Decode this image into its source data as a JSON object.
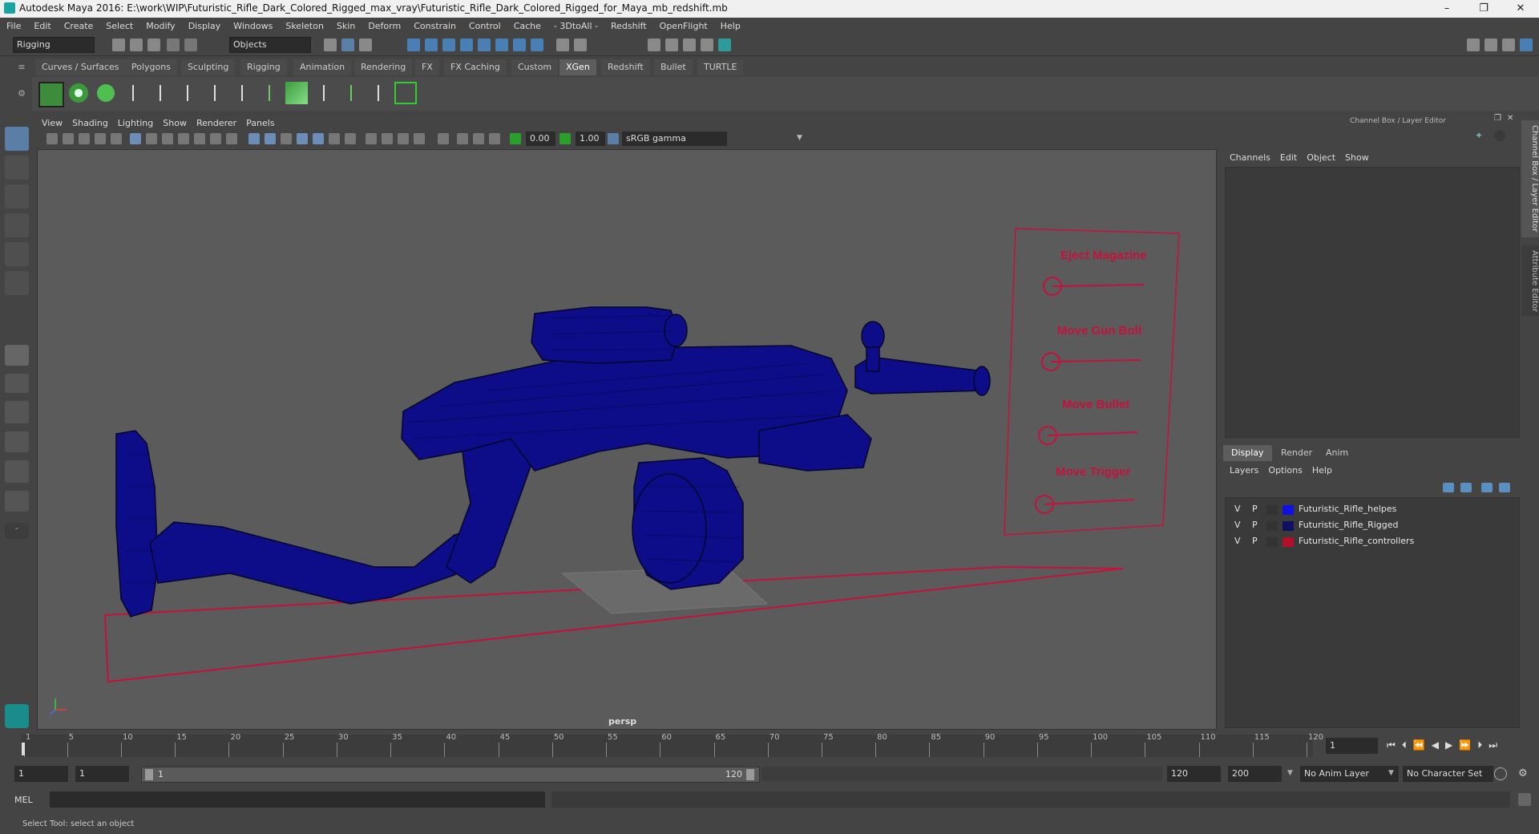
{
  "window": {
    "title": "Autodesk Maya 2016: E:\\work\\WIP\\Futuristic_Rifle_Dark_Colored_Rigged_max_vray\\Futuristic_Rifle_Dark_Colored_Rigged_for_Maya_mb_redshift.mb",
    "minimize": "–",
    "restore": "❐",
    "close": "✕"
  },
  "menus": [
    "File",
    "Edit",
    "Create",
    "Select",
    "Modify",
    "Display",
    "Windows",
    "Skeleton",
    "Skin",
    "Deform",
    "Constrain",
    "Control",
    "Cache",
    "- 3DtoAll -",
    "Redshift",
    "OpenFlight",
    "Help"
  ],
  "statusline": {
    "mode": "Rigging",
    "select_mode": "Objects"
  },
  "shelf_tabs": [
    "Curves / Surfaces",
    "Polygons",
    "Sculpting",
    "Rigging",
    "Animation",
    "Rendering",
    "FX",
    "FX Caching",
    "Custom",
    "XGen",
    "Redshift",
    "Bullet",
    "TURTLE"
  ],
  "active_shelf": "XGen",
  "viewport": {
    "menus": [
      "View",
      "Shading",
      "Lighting",
      "Show",
      "Renderer",
      "Panels"
    ],
    "near_value": "0.00",
    "far_value": "1.00",
    "color_space": "sRGB gamma",
    "camera": "persp",
    "controller_labels": [
      "Eject Magazine",
      "Move Gun Bolt",
      "Move Bullet",
      "Move Trigger"
    ]
  },
  "channel_box": {
    "title": "Channel Box / Layer Editor",
    "menus": [
      "Channels",
      "Edit",
      "Object",
      "Show"
    ],
    "layer_tabs": [
      "Display",
      "Render",
      "Anim"
    ],
    "active_layer_tab": "Display",
    "layer_menus": [
      "Layers",
      "Options",
      "Help"
    ],
    "layers": [
      {
        "v": "V",
        "p": "P",
        "color": "#1010e0",
        "name": "Futuristic_Rifle_helpes"
      },
      {
        "v": "V",
        "p": "P",
        "color": "#101060",
        "name": "Futuristic_Rifle_Rigged"
      },
      {
        "v": "V",
        "p": "P",
        "color": "#b0102a",
        "name": "Futuristic_Rifle_controllers"
      }
    ]
  },
  "side_tabs": {
    "channel_box": "Channel Box / Layer Editor",
    "attribute_editor": "Attribute Editor"
  },
  "timeline": {
    "ticks": [
      "1",
      "5",
      "10",
      "15",
      "20",
      "25",
      "30",
      "35",
      "40",
      "45",
      "50",
      "55",
      "60",
      "65",
      "70",
      "75",
      "80",
      "85",
      "90",
      "95",
      "100",
      "105",
      "110",
      "115",
      "120"
    ],
    "current_frame": "1"
  },
  "range": {
    "start": "1",
    "playback_start": "1",
    "range_start_label": "1",
    "range_end_label": "120",
    "playback_end": "120",
    "end": "200",
    "anim_layer": "No Anim Layer",
    "character_set": "No Character Set"
  },
  "cmdline": {
    "label": "MEL"
  },
  "help_line": "Select Tool: select an object",
  "colors": {
    "mesh": "#0d0d8a",
    "controller": "#c4123a",
    "bg": "#5b5b5b"
  }
}
